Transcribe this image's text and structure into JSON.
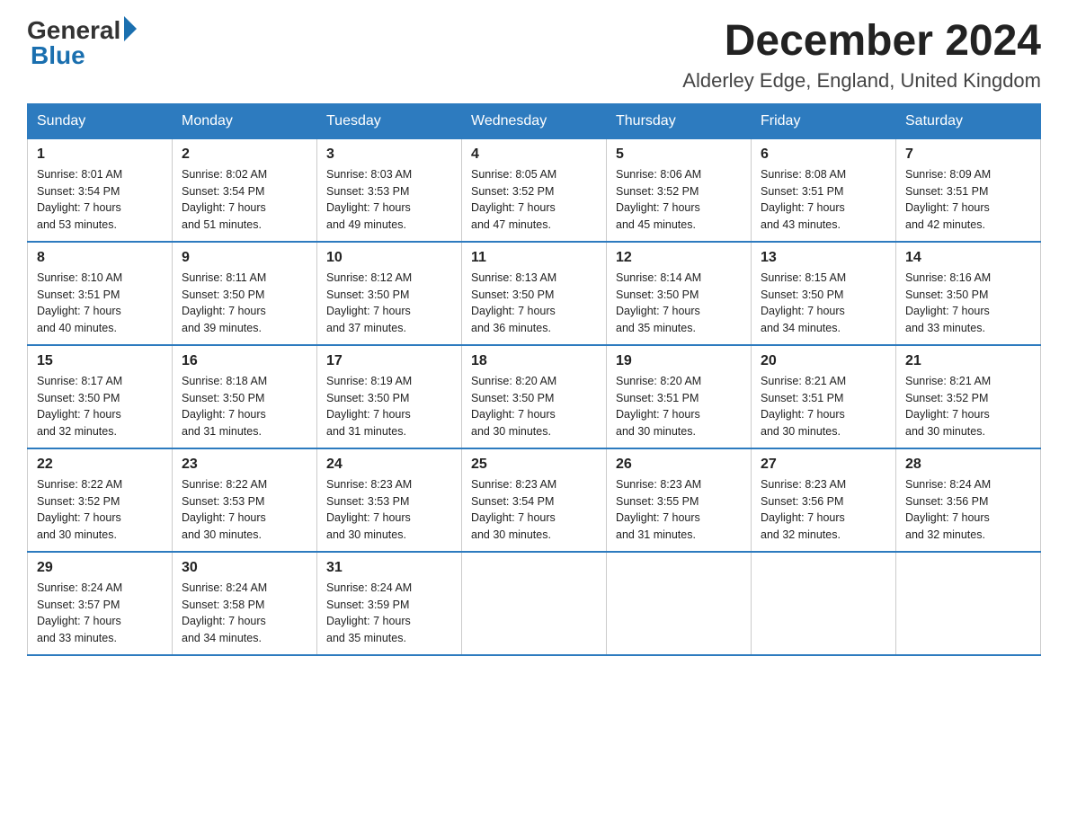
{
  "logo": {
    "general": "General",
    "blue": "Blue",
    "triangle": "▶"
  },
  "title": "December 2024",
  "subtitle": "Alderley Edge, England, United Kingdom",
  "days_header": [
    "Sunday",
    "Monday",
    "Tuesday",
    "Wednesday",
    "Thursday",
    "Friday",
    "Saturday"
  ],
  "weeks": [
    [
      {
        "day": "1",
        "sunrise": "8:01 AM",
        "sunset": "3:54 PM",
        "daylight": "7 hours and 53 minutes."
      },
      {
        "day": "2",
        "sunrise": "8:02 AM",
        "sunset": "3:54 PM",
        "daylight": "7 hours and 51 minutes."
      },
      {
        "day": "3",
        "sunrise": "8:03 AM",
        "sunset": "3:53 PM",
        "daylight": "7 hours and 49 minutes."
      },
      {
        "day": "4",
        "sunrise": "8:05 AM",
        "sunset": "3:52 PM",
        "daylight": "7 hours and 47 minutes."
      },
      {
        "day": "5",
        "sunrise": "8:06 AM",
        "sunset": "3:52 PM",
        "daylight": "7 hours and 45 minutes."
      },
      {
        "day": "6",
        "sunrise": "8:08 AM",
        "sunset": "3:51 PM",
        "daylight": "7 hours and 43 minutes."
      },
      {
        "day": "7",
        "sunrise": "8:09 AM",
        "sunset": "3:51 PM",
        "daylight": "7 hours and 42 minutes."
      }
    ],
    [
      {
        "day": "8",
        "sunrise": "8:10 AM",
        "sunset": "3:51 PM",
        "daylight": "7 hours and 40 minutes."
      },
      {
        "day": "9",
        "sunrise": "8:11 AM",
        "sunset": "3:50 PM",
        "daylight": "7 hours and 39 minutes."
      },
      {
        "day": "10",
        "sunrise": "8:12 AM",
        "sunset": "3:50 PM",
        "daylight": "7 hours and 37 minutes."
      },
      {
        "day": "11",
        "sunrise": "8:13 AM",
        "sunset": "3:50 PM",
        "daylight": "7 hours and 36 minutes."
      },
      {
        "day": "12",
        "sunrise": "8:14 AM",
        "sunset": "3:50 PM",
        "daylight": "7 hours and 35 minutes."
      },
      {
        "day": "13",
        "sunrise": "8:15 AM",
        "sunset": "3:50 PM",
        "daylight": "7 hours and 34 minutes."
      },
      {
        "day": "14",
        "sunrise": "8:16 AM",
        "sunset": "3:50 PM",
        "daylight": "7 hours and 33 minutes."
      }
    ],
    [
      {
        "day": "15",
        "sunrise": "8:17 AM",
        "sunset": "3:50 PM",
        "daylight": "7 hours and 32 minutes."
      },
      {
        "day": "16",
        "sunrise": "8:18 AM",
        "sunset": "3:50 PM",
        "daylight": "7 hours and 31 minutes."
      },
      {
        "day": "17",
        "sunrise": "8:19 AM",
        "sunset": "3:50 PM",
        "daylight": "7 hours and 31 minutes."
      },
      {
        "day": "18",
        "sunrise": "8:20 AM",
        "sunset": "3:50 PM",
        "daylight": "7 hours and 30 minutes."
      },
      {
        "day": "19",
        "sunrise": "8:20 AM",
        "sunset": "3:51 PM",
        "daylight": "7 hours and 30 minutes."
      },
      {
        "day": "20",
        "sunrise": "8:21 AM",
        "sunset": "3:51 PM",
        "daylight": "7 hours and 30 minutes."
      },
      {
        "day": "21",
        "sunrise": "8:21 AM",
        "sunset": "3:52 PM",
        "daylight": "7 hours and 30 minutes."
      }
    ],
    [
      {
        "day": "22",
        "sunrise": "8:22 AM",
        "sunset": "3:52 PM",
        "daylight": "7 hours and 30 minutes."
      },
      {
        "day": "23",
        "sunrise": "8:22 AM",
        "sunset": "3:53 PM",
        "daylight": "7 hours and 30 minutes."
      },
      {
        "day": "24",
        "sunrise": "8:23 AM",
        "sunset": "3:53 PM",
        "daylight": "7 hours and 30 minutes."
      },
      {
        "day": "25",
        "sunrise": "8:23 AM",
        "sunset": "3:54 PM",
        "daylight": "7 hours and 30 minutes."
      },
      {
        "day": "26",
        "sunrise": "8:23 AM",
        "sunset": "3:55 PM",
        "daylight": "7 hours and 31 minutes."
      },
      {
        "day": "27",
        "sunrise": "8:23 AM",
        "sunset": "3:56 PM",
        "daylight": "7 hours and 32 minutes."
      },
      {
        "day": "28",
        "sunrise": "8:24 AM",
        "sunset": "3:56 PM",
        "daylight": "7 hours and 32 minutes."
      }
    ],
    [
      {
        "day": "29",
        "sunrise": "8:24 AM",
        "sunset": "3:57 PM",
        "daylight": "7 hours and 33 minutes."
      },
      {
        "day": "30",
        "sunrise": "8:24 AM",
        "sunset": "3:58 PM",
        "daylight": "7 hours and 34 minutes."
      },
      {
        "day": "31",
        "sunrise": "8:24 AM",
        "sunset": "3:59 PM",
        "daylight": "7 hours and 35 minutes."
      },
      null,
      null,
      null,
      null
    ]
  ],
  "labels": {
    "sunrise": "Sunrise:",
    "sunset": "Sunset:",
    "daylight": "Daylight:"
  }
}
